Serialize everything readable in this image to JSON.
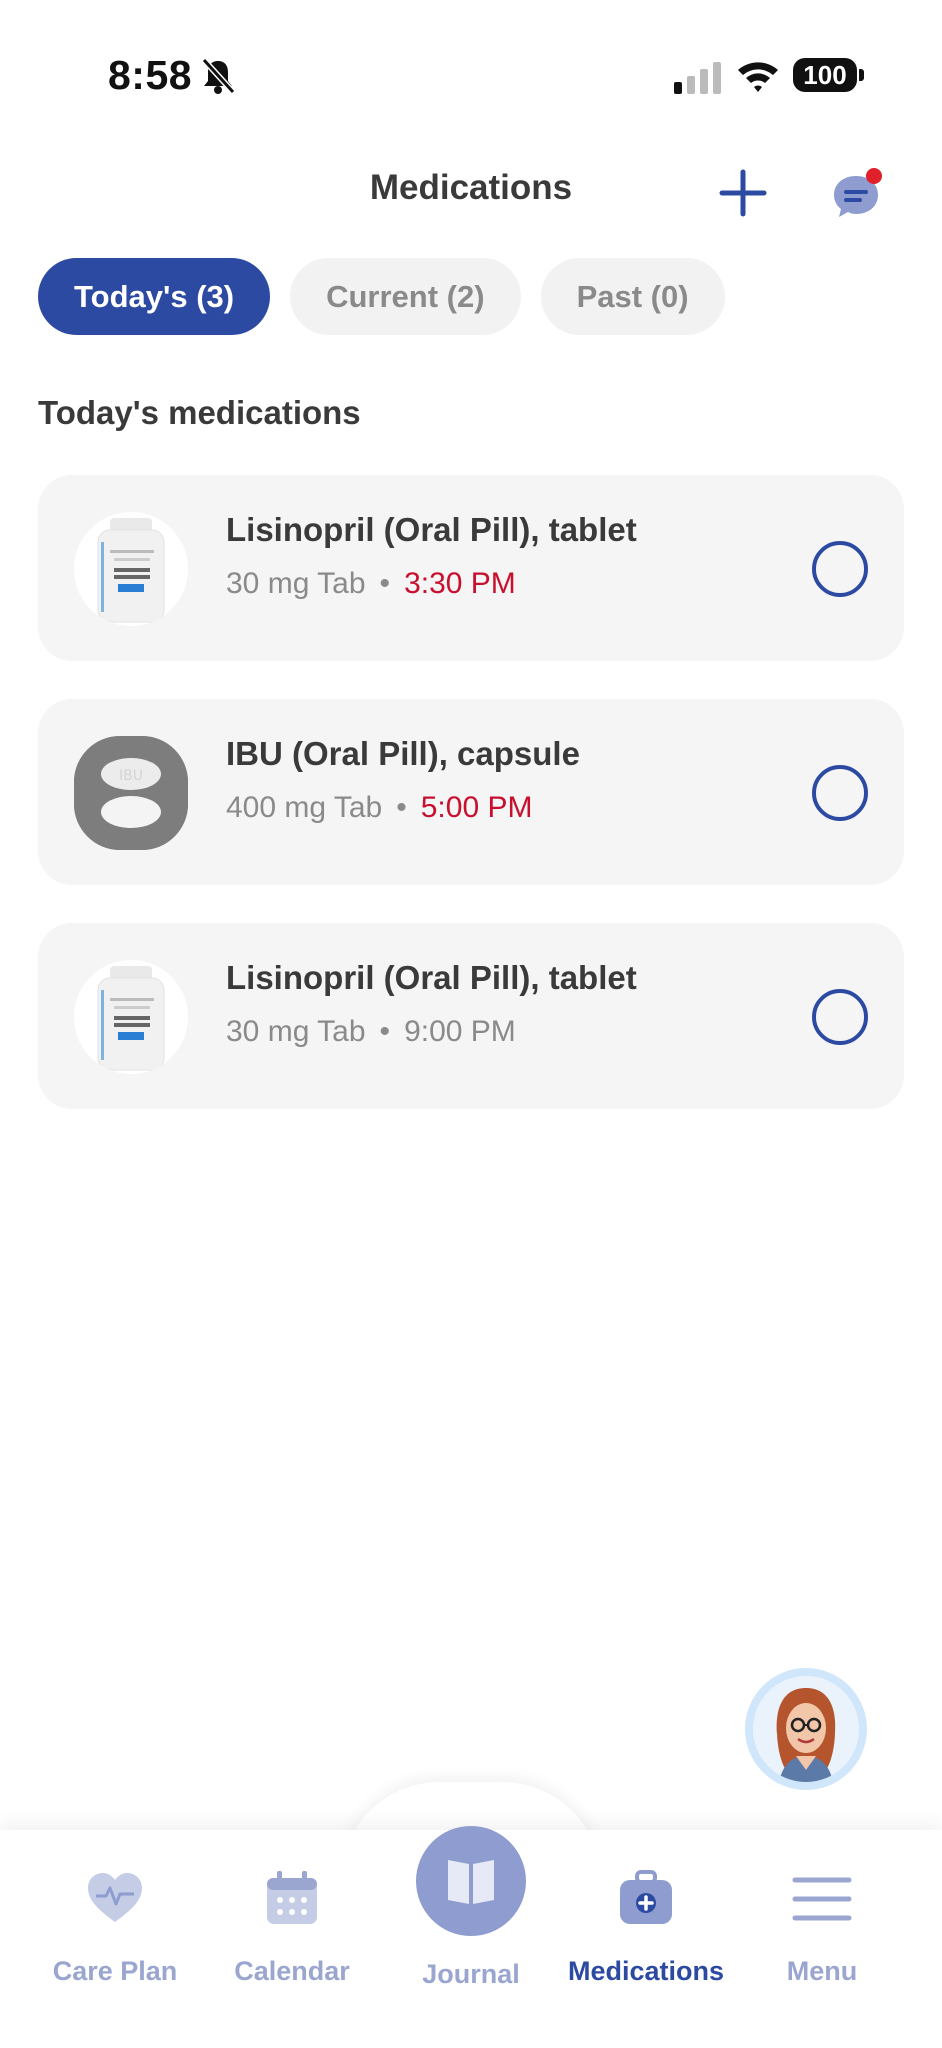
{
  "status_bar": {
    "time": "8:58",
    "battery": "100"
  },
  "header": {
    "title": "Medications"
  },
  "tabs": [
    {
      "label": "Today's (3)",
      "active": true
    },
    {
      "label": "Current (2)",
      "active": false
    },
    {
      "label": "Past (0)",
      "active": false
    }
  ],
  "section_title": "Today's medications",
  "medications": [
    {
      "name": "Lisinopril (Oral Pill), tablet",
      "dose": "30 mg Tab",
      "time": "3:30 PM",
      "overdue": true,
      "image": "pill-bottle"
    },
    {
      "name": "IBU (Oral Pill), capsule",
      "dose": "400 mg Tab",
      "time": "5:00 PM",
      "overdue": true,
      "image": "white-pills"
    },
    {
      "name": "Lisinopril (Oral Pill), tablet",
      "dose": "30 mg Tab",
      "time": "9:00 PM",
      "overdue": false,
      "image": "pill-bottle"
    }
  ],
  "bottom_nav": {
    "care_plan": "Care Plan",
    "calendar": "Calendar",
    "journal": "Journal",
    "medications": "Medications",
    "menu": "Menu"
  },
  "colors": {
    "primary": "#2d4aa3",
    "overdue": "#c8102e",
    "nav_inactive": "#9aa6cf",
    "card_bg": "#f5f5f6"
  }
}
